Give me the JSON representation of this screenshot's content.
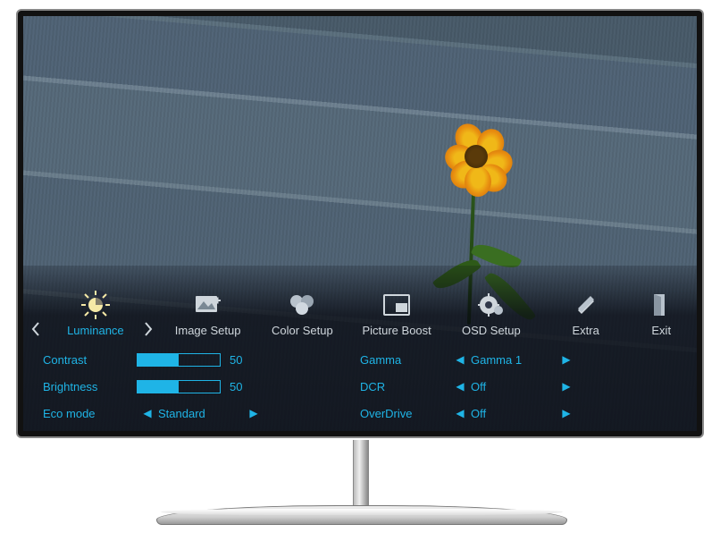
{
  "osd": {
    "tabs": [
      {
        "label": "Luminance",
        "icon": "sun-icon",
        "active": true
      },
      {
        "label": "Image Setup",
        "icon": "image-icon",
        "active": false
      },
      {
        "label": "Color Setup",
        "icon": "palette-icon",
        "active": false
      },
      {
        "label": "Picture Boost",
        "icon": "pip-icon",
        "active": false
      },
      {
        "label": "OSD Setup",
        "icon": "gear-icon",
        "active": false
      },
      {
        "label": "Extra",
        "icon": "tools-icon",
        "active": false
      },
      {
        "label": "Exit",
        "icon": "exit-icon",
        "active": false
      }
    ],
    "left_col": {
      "contrast": {
        "label": "Contrast",
        "value": 50
      },
      "brightness": {
        "label": "Brightness",
        "value": 50
      },
      "eco": {
        "label": "Eco mode",
        "value": "Standard"
      }
    },
    "right_col": {
      "gamma": {
        "label": "Gamma",
        "value": "Gamma 1"
      },
      "dcr": {
        "label": "DCR",
        "value": "Off"
      },
      "overdrive": {
        "label": "OverDrive",
        "value": "Off"
      }
    }
  },
  "colors": {
    "accent": "#1fb4e6"
  }
}
